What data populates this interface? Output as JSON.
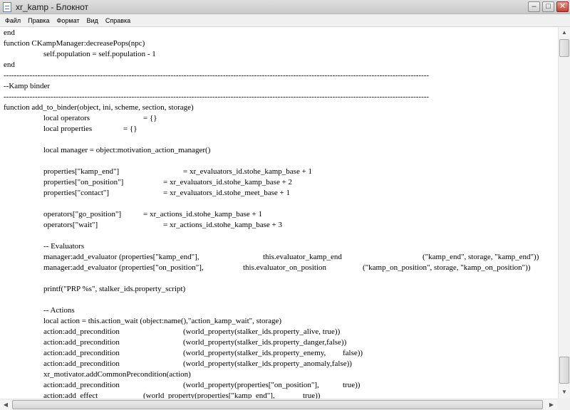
{
  "window": {
    "title": "xr_kamp - Блокнот",
    "minimize": "–",
    "maximize": "□",
    "close": "✕"
  },
  "menu": [
    "Файл",
    "Правка",
    "Формат",
    "Вид",
    "Справка"
  ],
  "editor": {
    "lines": [
      "end",
      "function CKampManager:decreasePops(npc)",
      "\t\tself.population = self.population - 1",
      "end",
      "-------------------------------------------------------------------------------------------------------------------------------------------------------------------",
      "--Kamp binder",
      "-------------------------------------------------------------------------------------------------------------------------------------------------------------------",
      "function add_to_binder(object, ini, scheme, section, storage)",
      "\t\tlocal operators\t\t\t= {}",
      "\t\tlocal properties\t\t= {}",
      "",
      "\t\tlocal manager = object:motivation_action_manager()",
      "",
      "\t\tproperties[\"kamp_end\"]\t\t\t\t= xr_evaluators_id.stohe_kamp_base + 1",
      "\t\tproperties[\"on_position\"]\t\t= xr_evaluators_id.stohe_kamp_base + 2",
      "\t\tproperties[\"contact\"]\t\t\t= xr_evaluators_id.stohe_meet_base + 1",
      "",
      "\t\toperators[\"go_position\"]\t\t= xr_actions_id.stohe_kamp_base + 1",
      "\t\toperators[\"wait\"]\t\t\t\t= xr_actions_id.stohe_kamp_base + 3",
      "",
      "\t\t-- Evaluators",
      "\t\tmanager:add_evaluator (properties[\"kamp_end\"],\t\t\t\tthis.evaluator_kamp_end\t\t\t\t(\"kamp_end\", storage, \"kamp_end\"))",
      "\t\tmanager:add_evaluator (properties[\"on_position\"],\t\tthis.evaluator_on_position\t\t(\"kamp_on_position\", storage, \"kamp_on_position\"))",
      "",
      "\t\tprintf(\"PRP %s\", stalker_ids.property_script)",
      "",
      "\t\t-- Actions",
      "\t\tlocal action = this.action_wait (object:name(),\"action_kamp_wait\", storage)",
      "\t\taction:add_precondition\t\t\t\t(world_property(stalker_ids.property_alive, true))",
      "\t\taction:add_precondition\t\t\t\t(world_property(stalker_ids.property_danger,false))",
      "\t\taction:add_precondition\t\t\t\t(world_property(stalker_ids.property_enemy,\tfalse))",
      "\t\taction:add_precondition\t\t\t\t(world_property(stalker_ids.property_anomaly,false))",
      "\t\txr_motivator.addCommonPrecondition(action)",
      "\t\taction:add_precondition\t\t\t\t(world_property(properties[\"on_position\"],\t\ttrue))",
      "\t\taction:add_effect\t\t\t(world_property(properties[\"kamp_end\"],\t\ttrue))"
    ]
  },
  "scrollbar": {
    "up": "▲",
    "down": "▼",
    "left": "◀",
    "right": "▶"
  }
}
